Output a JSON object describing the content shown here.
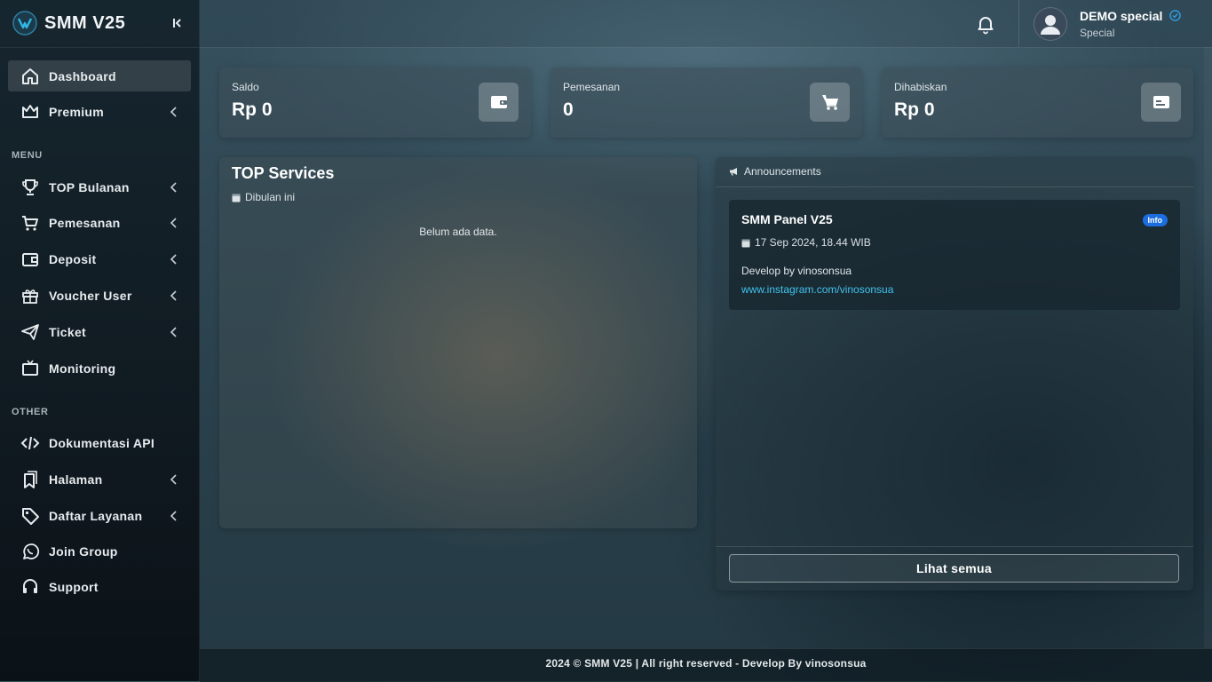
{
  "brand": {
    "name": "SMM V25"
  },
  "sidebar": {
    "items_top": [
      {
        "label": "Dashboard",
        "icon": "home-icon",
        "active": true,
        "submenu": false
      },
      {
        "label": "Premium",
        "icon": "crown-icon",
        "active": false,
        "submenu": true
      }
    ],
    "section_menu": "MENU",
    "items_menu": [
      {
        "label": "TOP Bulanan",
        "icon": "trophy-icon",
        "submenu": true
      },
      {
        "label": "Pemesanan",
        "icon": "cart-icon",
        "submenu": true
      },
      {
        "label": "Deposit",
        "icon": "wallet-icon",
        "submenu": true
      },
      {
        "label": "Voucher User",
        "icon": "gift-icon",
        "submenu": true
      },
      {
        "label": "Ticket",
        "icon": "paper-plane-icon",
        "submenu": true
      },
      {
        "label": "Monitoring",
        "icon": "tv-icon",
        "submenu": false
      }
    ],
    "section_other": "OTHER",
    "items_other": [
      {
        "label": "Dokumentasi API",
        "icon": "code-icon",
        "submenu": false
      },
      {
        "label": "Halaman",
        "icon": "bookmarks-icon",
        "submenu": true
      },
      {
        "label": "Daftar Layanan",
        "icon": "tag-icon",
        "submenu": true
      },
      {
        "label": "Join Group",
        "icon": "whatsapp-icon",
        "submenu": false
      },
      {
        "label": "Support",
        "icon": "headset-icon",
        "submenu": false
      }
    ]
  },
  "user": {
    "name": "DEMO special",
    "role": "Special"
  },
  "stats": [
    {
      "label": "Saldo",
      "value": "Rp 0",
      "icon": "wallet-icon"
    },
    {
      "label": "Pemesanan",
      "value": "0",
      "icon": "cart-icon"
    },
    {
      "label": "Dihabiskan",
      "value": "Rp 0",
      "icon": "card-icon"
    }
  ],
  "top_services": {
    "title": "TOP Services",
    "subtitle": "Dibulan ini",
    "empty": "Belum ada data."
  },
  "announcements": {
    "header": "Announcements",
    "item": {
      "title": "SMM Panel V25",
      "badge": "Info",
      "date": "17 Sep 2024, 18.44 WIB",
      "body": "Develop by vinosonsua",
      "link": "www.instagram.com/vinosonsua"
    },
    "see_all": "Lihat semua"
  },
  "footer": {
    "text": "2024 © SMM V25 | All right reserved - Develop By vinosonsua"
  },
  "colors": {
    "accent": "#1c6ee0",
    "link": "#3fc3ee",
    "sidebar_bg": "#101a21"
  }
}
